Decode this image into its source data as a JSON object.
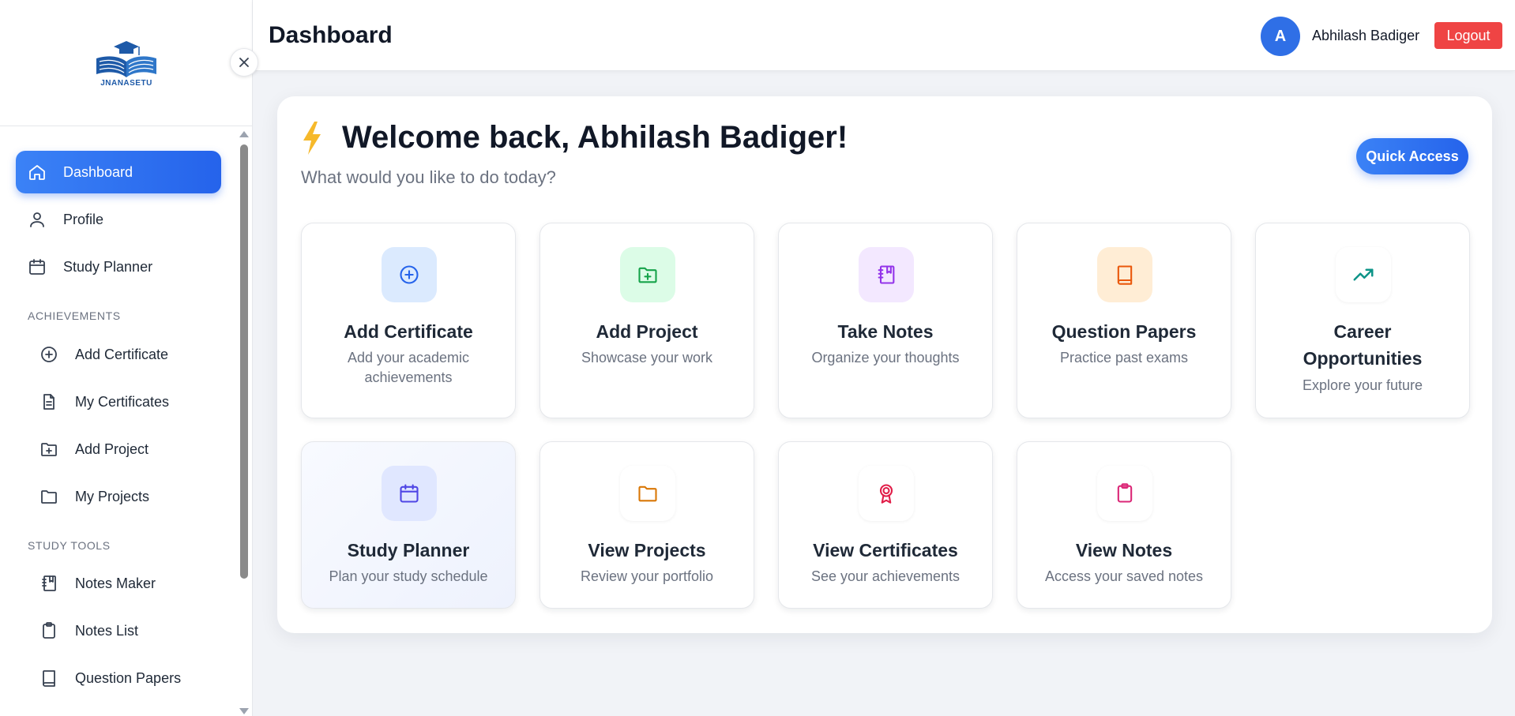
{
  "brand": {
    "logo_text": "JNANASETU",
    "logo_color": "#1e5aa8"
  },
  "sidebar": {
    "items": [
      {
        "label": "Dashboard",
        "icon": "home-icon",
        "active": true
      },
      {
        "label": "Profile",
        "icon": "user-icon"
      },
      {
        "label": "Study Planner",
        "icon": "calendar-icon"
      }
    ],
    "sections": [
      {
        "label": "ACHIEVEMENTS",
        "items": [
          {
            "label": "Add Certificate",
            "icon": "plus-circle-icon"
          },
          {
            "label": "My Certificates",
            "icon": "document-icon"
          },
          {
            "label": "Add Project",
            "icon": "folder-plus-icon"
          },
          {
            "label": "My Projects",
            "icon": "folder-icon"
          }
        ]
      },
      {
        "label": "STUDY TOOLS",
        "items": [
          {
            "label": "Notes Maker",
            "icon": "notebook-icon"
          },
          {
            "label": "Notes List",
            "icon": "clipboard-icon"
          },
          {
            "label": "Question Papers",
            "icon": "book-icon"
          }
        ]
      }
    ]
  },
  "header": {
    "title": "Dashboard",
    "avatar_initial": "A",
    "username": "Abhilash Badiger",
    "logout_label": "Logout"
  },
  "welcome": {
    "heading": "Welcome back, Abhilash Badiger!",
    "subtitle": "What would you like to do today?",
    "quick_access_label": "Quick Access"
  },
  "tiles": [
    {
      "title": "Add Certificate",
      "desc": "Add your academic achievements",
      "icon": "plus-circle-icon",
      "color": "#2563eb",
      "bg": "#dbeafe"
    },
    {
      "title": "Add Project",
      "desc": "Showcase your work",
      "icon": "folder-plus-icon",
      "color": "#16a34a",
      "bg": "#dcfce7"
    },
    {
      "title": "Take Notes",
      "desc": "Organize your thoughts",
      "icon": "notebook-icon",
      "color": "#9333ea",
      "bg": "#f3e8ff"
    },
    {
      "title": "Question Papers",
      "desc": "Practice past exams",
      "icon": "book-icon",
      "color": "#ea580c",
      "bg": "#ffedd5"
    },
    {
      "title": "Career Opportunities",
      "desc": "Explore your future",
      "icon": "trending-up-icon",
      "color": "#0d9488",
      "bg": "#ffffff"
    },
    {
      "title": "Study Planner",
      "desc": "Plan your study schedule",
      "icon": "calendar-icon",
      "color": "#4f46e5",
      "bg": "#e0e7ff"
    },
    {
      "title": "View Projects",
      "desc": "Review your portfolio",
      "icon": "folder-icon",
      "color": "#d97706",
      "bg": "#ffffff"
    },
    {
      "title": "View Certificates",
      "desc": "See your achievements",
      "icon": "award-icon",
      "color": "#e11d48",
      "bg": "#ffffff"
    },
    {
      "title": "View Notes",
      "desc": "Access your saved notes",
      "icon": "clipboard-icon",
      "color": "#db2777",
      "bg": "#ffffff"
    }
  ],
  "colors": {
    "accent": "#2563eb",
    "logout": "#ef4444",
    "bolt": "#f6b92b"
  }
}
